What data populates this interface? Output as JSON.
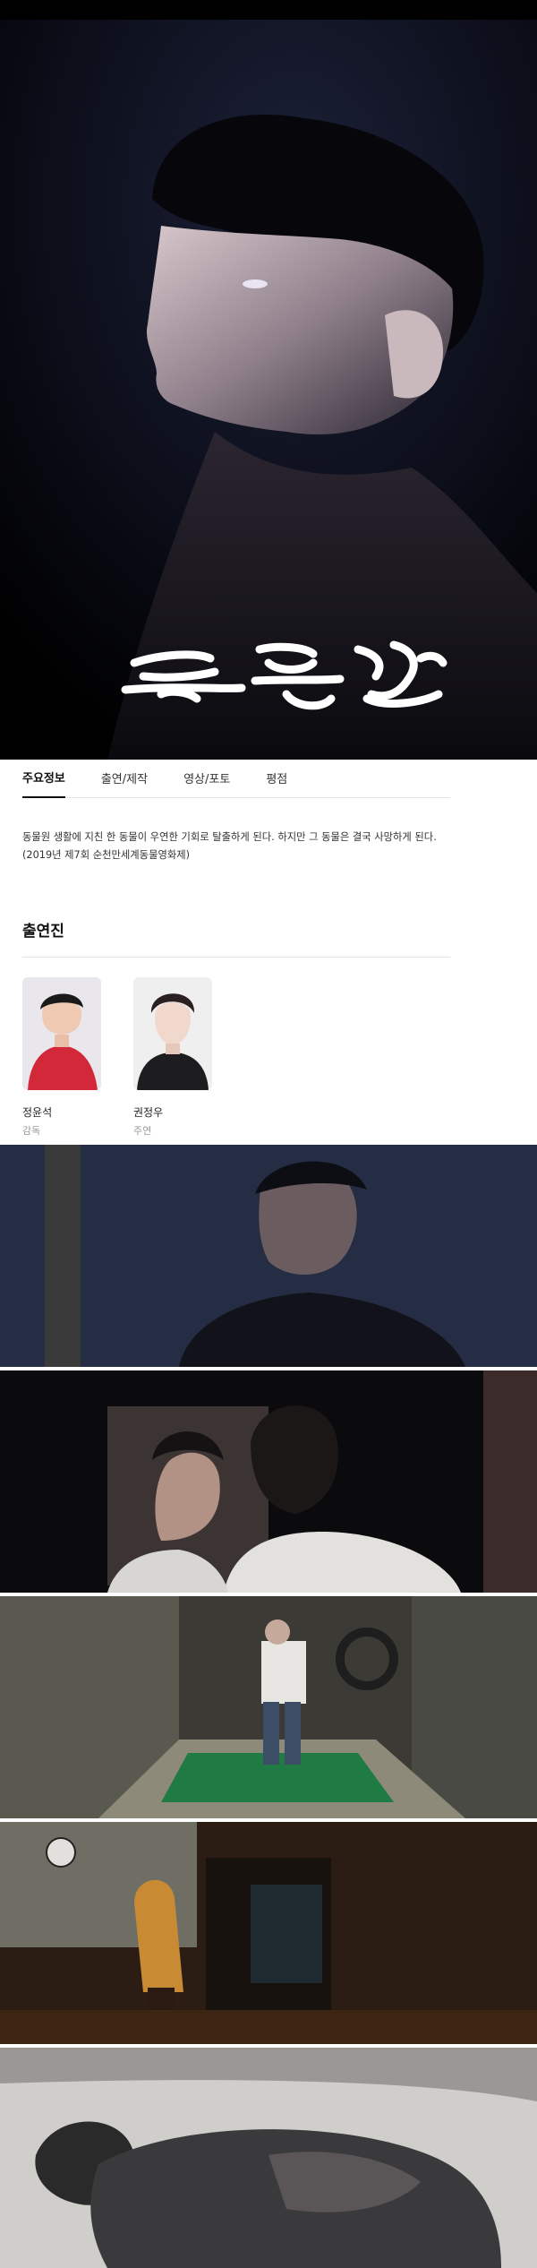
{
  "tabs": [
    {
      "label": "주요정보"
    },
    {
      "label": "출연/제작"
    },
    {
      "label": "영상/포토"
    },
    {
      "label": "평점"
    }
  ],
  "synopsis": {
    "line1": "동물원 생활에 지친 한 동물이 우연한 기회로 탈출하게 된다. 하지만 그 동물은 결국 사망하게 된다.",
    "line2": "(2019년 제7회 순천만세계동물영화제)"
  },
  "cast_section": {
    "title": "출연진"
  },
  "cast": [
    {
      "name": "정윤석",
      "role": "감독"
    },
    {
      "name": "권정우",
      "role": "주연"
    }
  ],
  "hero": {
    "title_art_text": "동물원"
  }
}
